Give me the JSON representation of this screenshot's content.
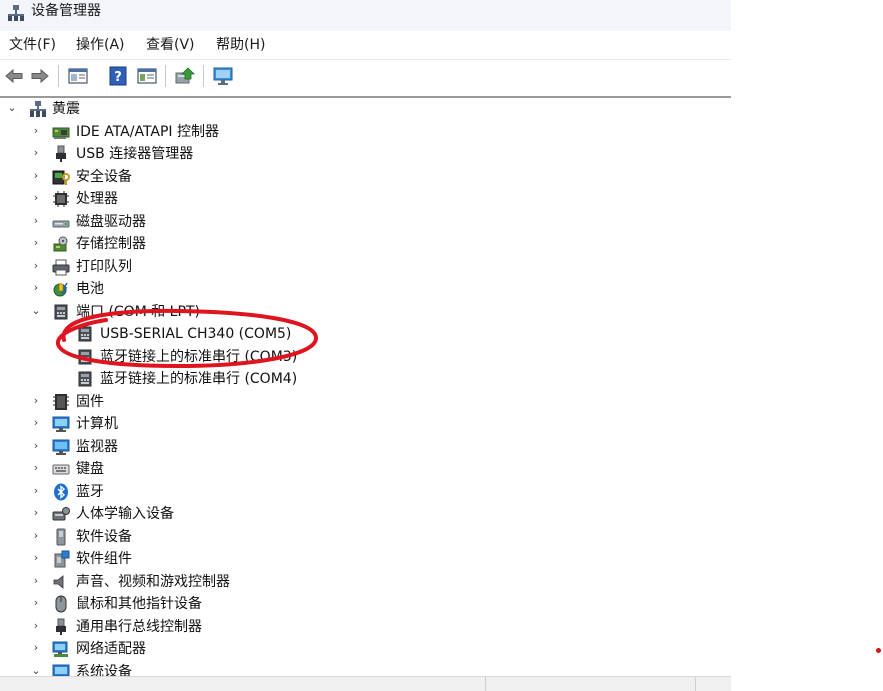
{
  "window": {
    "title": "设备管理器"
  },
  "menu": [
    {
      "label": "文件(F)"
    },
    {
      "label": "操作(A)"
    },
    {
      "label": "查看(V)"
    },
    {
      "label": "帮助(H)"
    }
  ],
  "toolbar": [
    {
      "name": "back-arrow-icon"
    },
    {
      "name": "forward-arrow-icon"
    },
    {
      "name": "properties-window-icon"
    },
    {
      "name": "help-icon"
    },
    {
      "name": "show-hide-console-tree-icon"
    },
    {
      "name": "update-driver-icon"
    },
    {
      "name": "scan-hardware-monitor-icon"
    }
  ],
  "tree": {
    "root": {
      "label": "黄震",
      "expanded": true,
      "icon": "computer-root-icon"
    },
    "items": [
      {
        "label": "IDE ATA/ATAPI 控制器",
        "icon": "ide-controller-icon",
        "expanded": false
      },
      {
        "label": "USB 连接器管理器",
        "icon": "usb-connector-icon",
        "expanded": false
      },
      {
        "label": "安全设备",
        "icon": "security-device-icon",
        "expanded": false
      },
      {
        "label": "处理器",
        "icon": "processor-icon",
        "expanded": false
      },
      {
        "label": "磁盘驱动器",
        "icon": "disk-drive-icon",
        "expanded": false
      },
      {
        "label": "存储控制器",
        "icon": "storage-controller-icon",
        "expanded": false
      },
      {
        "label": "打印队列",
        "icon": "printer-icon",
        "expanded": false
      },
      {
        "label": "电池",
        "icon": "battery-icon",
        "expanded": false
      },
      {
        "label": "端口 (COM 和 LPT)",
        "icon": "port-icon",
        "expanded": true
      },
      {
        "label": "固件",
        "icon": "firmware-icon",
        "expanded": false
      },
      {
        "label": "计算机",
        "icon": "computer-icon",
        "expanded": false
      },
      {
        "label": "监视器",
        "icon": "monitor-icon",
        "expanded": false
      },
      {
        "label": "键盘",
        "icon": "keyboard-icon",
        "expanded": false
      },
      {
        "label": "蓝牙",
        "icon": "bluetooth-icon",
        "expanded": false
      },
      {
        "label": "人体学输入设备",
        "icon": "hid-icon",
        "expanded": false
      },
      {
        "label": "软件设备",
        "icon": "software-device-icon",
        "expanded": false
      },
      {
        "label": "软件组件",
        "icon": "software-component-icon",
        "expanded": false
      },
      {
        "label": "声音、视频和游戏控制器",
        "icon": "sound-icon",
        "expanded": false
      },
      {
        "label": "鼠标和其他指针设备",
        "icon": "mouse-icon",
        "expanded": false
      },
      {
        "label": "通用串行总线控制器",
        "icon": "usb-controller-icon",
        "expanded": false
      },
      {
        "label": "网络适配器",
        "icon": "network-adapter-icon",
        "expanded": false
      },
      {
        "label": "系统设备",
        "icon": "system-device-icon",
        "expanded": true
      }
    ],
    "port_children": [
      {
        "label": "USB-SERIAL CH340 (COM5)",
        "icon": "port-icon"
      },
      {
        "label": "蓝牙链接上的标准串行 (COM3)",
        "icon": "port-icon"
      },
      {
        "label": "蓝牙链接上的标准串行 (COM4)",
        "icon": "port-icon"
      }
    ]
  },
  "annotation": {
    "color": "#e0141e"
  }
}
